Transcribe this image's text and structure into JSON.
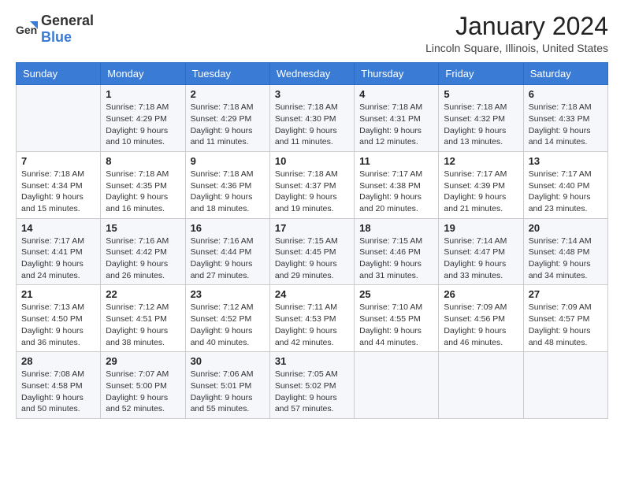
{
  "header": {
    "logo": {
      "general": "General",
      "blue": "Blue"
    },
    "title": "January 2024",
    "subtitle": "Lincoln Square, Illinois, United States"
  },
  "calendar": {
    "days_of_week": [
      "Sunday",
      "Monday",
      "Tuesday",
      "Wednesday",
      "Thursday",
      "Friday",
      "Saturday"
    ],
    "weeks": [
      [
        {
          "day": "",
          "info": ""
        },
        {
          "day": "1",
          "info": "Sunrise: 7:18 AM\nSunset: 4:29 PM\nDaylight: 9 hours and 10 minutes."
        },
        {
          "day": "2",
          "info": "Sunrise: 7:18 AM\nSunset: 4:29 PM\nDaylight: 9 hours and 11 minutes."
        },
        {
          "day": "3",
          "info": "Sunrise: 7:18 AM\nSunset: 4:30 PM\nDaylight: 9 hours and 11 minutes."
        },
        {
          "day": "4",
          "info": "Sunrise: 7:18 AM\nSunset: 4:31 PM\nDaylight: 9 hours and 12 minutes."
        },
        {
          "day": "5",
          "info": "Sunrise: 7:18 AM\nSunset: 4:32 PM\nDaylight: 9 hours and 13 minutes."
        },
        {
          "day": "6",
          "info": "Sunrise: 7:18 AM\nSunset: 4:33 PM\nDaylight: 9 hours and 14 minutes."
        }
      ],
      [
        {
          "day": "7",
          "info": "Sunrise: 7:18 AM\nSunset: 4:34 PM\nDaylight: 9 hours and 15 minutes."
        },
        {
          "day": "8",
          "info": "Sunrise: 7:18 AM\nSunset: 4:35 PM\nDaylight: 9 hours and 16 minutes."
        },
        {
          "day": "9",
          "info": "Sunrise: 7:18 AM\nSunset: 4:36 PM\nDaylight: 9 hours and 18 minutes."
        },
        {
          "day": "10",
          "info": "Sunrise: 7:18 AM\nSunset: 4:37 PM\nDaylight: 9 hours and 19 minutes."
        },
        {
          "day": "11",
          "info": "Sunrise: 7:17 AM\nSunset: 4:38 PM\nDaylight: 9 hours and 20 minutes."
        },
        {
          "day": "12",
          "info": "Sunrise: 7:17 AM\nSunset: 4:39 PM\nDaylight: 9 hours and 21 minutes."
        },
        {
          "day": "13",
          "info": "Sunrise: 7:17 AM\nSunset: 4:40 PM\nDaylight: 9 hours and 23 minutes."
        }
      ],
      [
        {
          "day": "14",
          "info": "Sunrise: 7:17 AM\nSunset: 4:41 PM\nDaylight: 9 hours and 24 minutes."
        },
        {
          "day": "15",
          "info": "Sunrise: 7:16 AM\nSunset: 4:42 PM\nDaylight: 9 hours and 26 minutes."
        },
        {
          "day": "16",
          "info": "Sunrise: 7:16 AM\nSunset: 4:44 PM\nDaylight: 9 hours and 27 minutes."
        },
        {
          "day": "17",
          "info": "Sunrise: 7:15 AM\nSunset: 4:45 PM\nDaylight: 9 hours and 29 minutes."
        },
        {
          "day": "18",
          "info": "Sunrise: 7:15 AM\nSunset: 4:46 PM\nDaylight: 9 hours and 31 minutes."
        },
        {
          "day": "19",
          "info": "Sunrise: 7:14 AM\nSunset: 4:47 PM\nDaylight: 9 hours and 33 minutes."
        },
        {
          "day": "20",
          "info": "Sunrise: 7:14 AM\nSunset: 4:48 PM\nDaylight: 9 hours and 34 minutes."
        }
      ],
      [
        {
          "day": "21",
          "info": "Sunrise: 7:13 AM\nSunset: 4:50 PM\nDaylight: 9 hours and 36 minutes."
        },
        {
          "day": "22",
          "info": "Sunrise: 7:12 AM\nSunset: 4:51 PM\nDaylight: 9 hours and 38 minutes."
        },
        {
          "day": "23",
          "info": "Sunrise: 7:12 AM\nSunset: 4:52 PM\nDaylight: 9 hours and 40 minutes."
        },
        {
          "day": "24",
          "info": "Sunrise: 7:11 AM\nSunset: 4:53 PM\nDaylight: 9 hours and 42 minutes."
        },
        {
          "day": "25",
          "info": "Sunrise: 7:10 AM\nSunset: 4:55 PM\nDaylight: 9 hours and 44 minutes."
        },
        {
          "day": "26",
          "info": "Sunrise: 7:09 AM\nSunset: 4:56 PM\nDaylight: 9 hours and 46 minutes."
        },
        {
          "day": "27",
          "info": "Sunrise: 7:09 AM\nSunset: 4:57 PM\nDaylight: 9 hours and 48 minutes."
        }
      ],
      [
        {
          "day": "28",
          "info": "Sunrise: 7:08 AM\nSunset: 4:58 PM\nDaylight: 9 hours and 50 minutes."
        },
        {
          "day": "29",
          "info": "Sunrise: 7:07 AM\nSunset: 5:00 PM\nDaylight: 9 hours and 52 minutes."
        },
        {
          "day": "30",
          "info": "Sunrise: 7:06 AM\nSunset: 5:01 PM\nDaylight: 9 hours and 55 minutes."
        },
        {
          "day": "31",
          "info": "Sunrise: 7:05 AM\nSunset: 5:02 PM\nDaylight: 9 hours and 57 minutes."
        },
        {
          "day": "",
          "info": ""
        },
        {
          "day": "",
          "info": ""
        },
        {
          "day": "",
          "info": ""
        }
      ]
    ]
  }
}
